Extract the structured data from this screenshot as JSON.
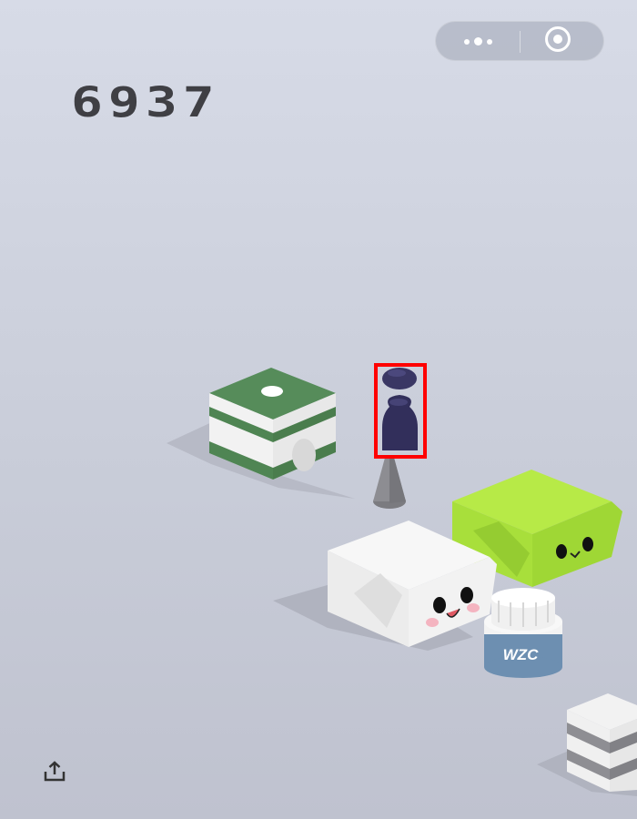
{
  "game": {
    "score": "6937"
  },
  "top_capsule": {
    "more_icon": "more-dots-icon",
    "close_icon": "target-close-icon"
  },
  "blocks": {
    "green_block": {
      "top": "#568c5a",
      "side": "#f0f0f0",
      "stripe": "#4f8553",
      "marker": "#ffffff"
    },
    "player_piece": {
      "color": "#3a3764",
      "highlight_box": "#ff0000"
    },
    "lime_block": {
      "top": "#b7ea47",
      "side": "#a3dc3a"
    },
    "white_block": {
      "top": "#f6f6f6",
      "side": "#eeeeee"
    },
    "jar": {
      "label": "WZC",
      "label_bg": "#6d8fb1"
    },
    "striped_block": {
      "light": "#f0f0f0",
      "dark": "#8e8e93"
    }
  },
  "bottom": {
    "share_icon": "share-upload-icon"
  }
}
